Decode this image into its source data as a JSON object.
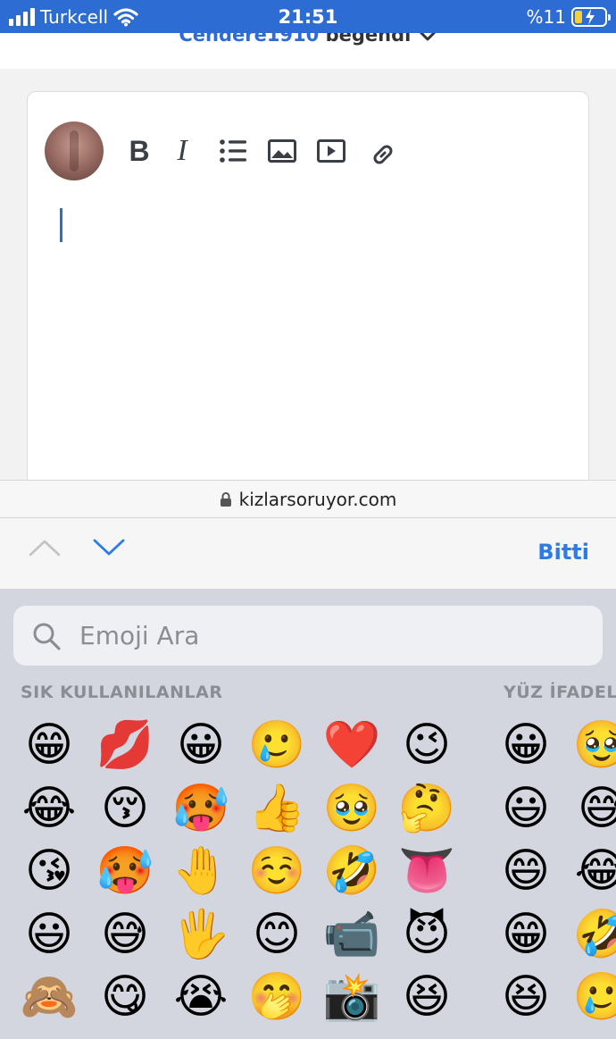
{
  "status_bar": {
    "carrier": "Turkcell",
    "time": "21:51",
    "battery": "%11"
  },
  "page": {
    "liked_user": "Cendere1910",
    "liked_verb": "beğendi"
  },
  "editor": {
    "toolbar": {
      "bold_label": "B",
      "italic_label": "I"
    }
  },
  "url_bar": {
    "domain": "kizlarsoruyor.com"
  },
  "accessory_bar": {
    "done_label": "Bitti"
  },
  "emoji_keyboard": {
    "search_placeholder": "Emoji Ara",
    "frequent_label": "SIK KULLANILANLAR",
    "faces_label": "YÜZ İFADEL",
    "frequent_columns": [
      [
        "😁",
        "😂",
        "😘",
        "😃",
        "🙈"
      ],
      [
        "💋",
        "😚",
        "🥵",
        "😅",
        "😋"
      ],
      [
        "😀",
        "🥵",
        "🤚",
        "🖐️",
        "😭"
      ],
      [
        "🥲",
        "👍",
        "☺️",
        "😊",
        "🤭"
      ],
      [
        "❤️",
        "🥹",
        "🤣",
        "📹",
        "📸"
      ],
      [
        "😉",
        "🤔",
        "👅",
        "😈",
        "😆"
      ]
    ],
    "faces_columns": [
      [
        "😀",
        "😃",
        "😄",
        "😁",
        "😆"
      ],
      [
        "🥹",
        "😅",
        "😂",
        "🤣",
        "🥲"
      ]
    ]
  },
  "colors": {
    "status_bar_bg": "#2d6cd3",
    "accent_blue": "#2d7be5",
    "keyboard_bg": "#d3d6de"
  },
  "icons": [
    "wifi-icon",
    "battery-charging-icon",
    "chevron-down-icon",
    "bold-icon",
    "italic-icon",
    "list-icon",
    "image-icon",
    "video-icon",
    "link-icon",
    "lock-icon",
    "chevron-up-icon",
    "search-icon"
  ]
}
